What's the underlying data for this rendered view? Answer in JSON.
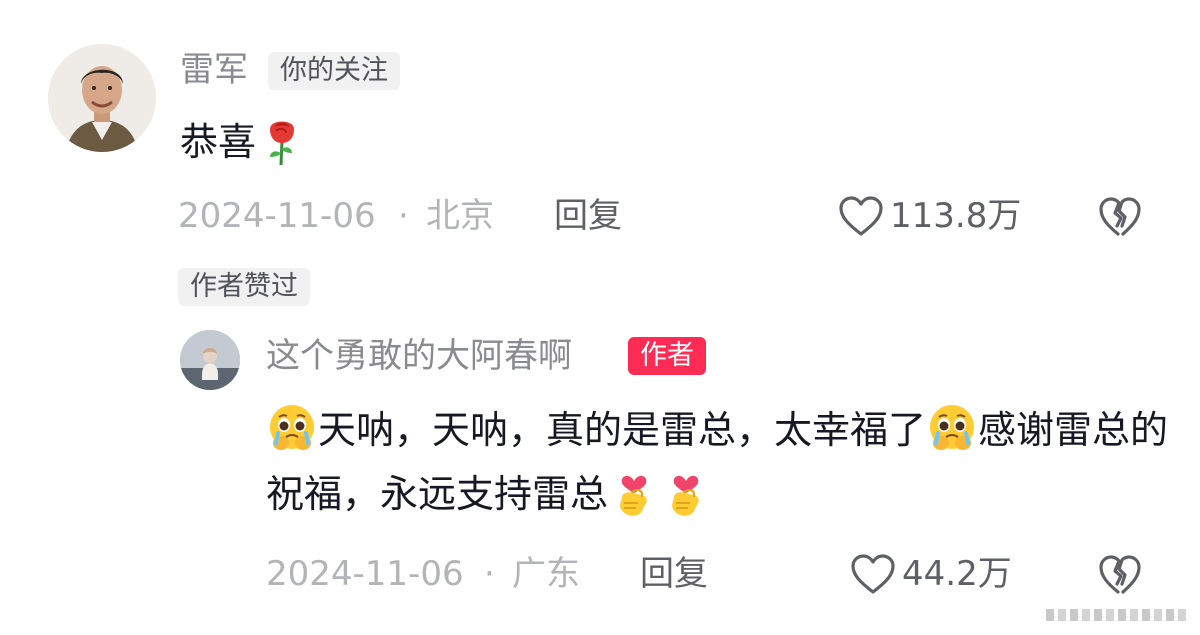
{
  "main_comment": {
    "username": "雷军",
    "follow_tag": "你的关注",
    "text": "恭喜",
    "emoji": "rose-icon",
    "date": "2024-11-06",
    "separator": "·",
    "location": "北京",
    "reply_label": "回复",
    "like_count": "113.8万"
  },
  "author_liked_tag": "作者赞过",
  "reply_comment": {
    "username": "这个勇敢的大阿春啊",
    "author_tag": "作者",
    "text_part1": "天呐，天呐，真的是雷总，太幸福了",
    "text_part2": "感谢雷总的祝福，永远支持雷总",
    "date": "2024-11-06",
    "separator": "·",
    "location": "广东",
    "reply_label": "回复",
    "like_count": "44.2万"
  },
  "colors": {
    "author_tag_bg": "#fe2c55",
    "meta_text": "#b3b4b8",
    "username_text": "#8a8b91"
  }
}
